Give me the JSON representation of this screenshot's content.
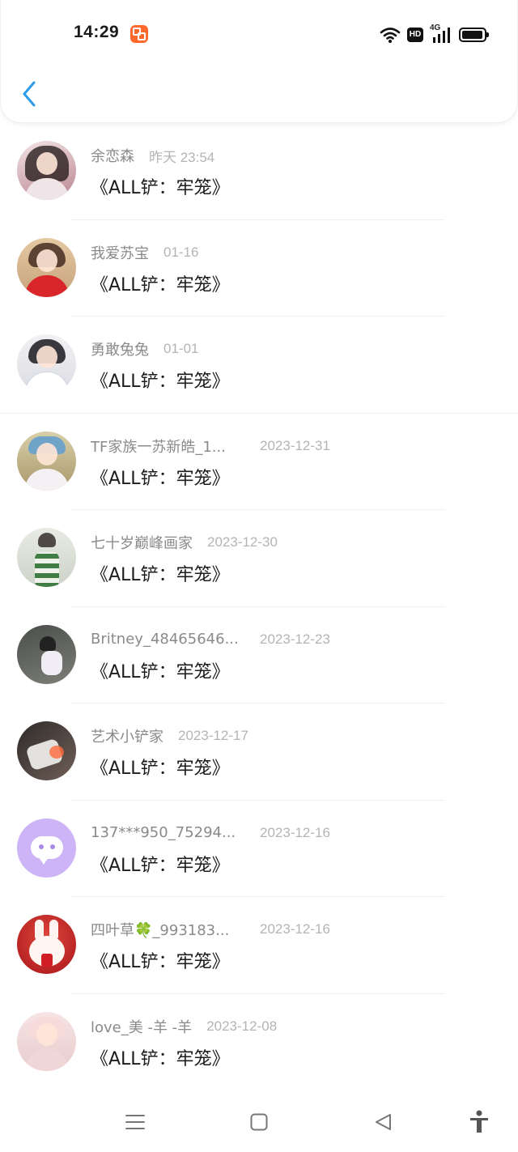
{
  "status_bar": {
    "time": "14:29",
    "hd_label": "HD",
    "network_label": "4G",
    "app_icon": "kuaishou-app-icon",
    "battery_level": 0.95
  },
  "header": {
    "back_icon": "chevron-left-icon",
    "accent_color": "#2b9bea"
  },
  "items": [
    {
      "name": "余恋森",
      "date": "昨天 23:54",
      "title": "《ALL铲：牢笼》"
    },
    {
      "name": "我爱苏宝",
      "date": "01-16",
      "title": "《ALL铲：牢笼》"
    },
    {
      "name": "勇敢兔兔",
      "date": "01-01",
      "title": "《ALL铲：牢笼》"
    },
    {
      "name": "TF家族一苏新皓_1...",
      "date": "2023-12-31",
      "title": "《ALL铲：牢笼》"
    },
    {
      "name": "七十岁巅峰画家",
      "date": "2023-12-30",
      "title": "《ALL铲：牢笼》"
    },
    {
      "name": "Britney_48465646...",
      "date": "2023-12-23",
      "title": "《ALL铲：牢笼》"
    },
    {
      "name": "艺术小铲家",
      "date": "2023-12-17",
      "title": "《ALL铲：牢笼》"
    },
    {
      "name": "137***950_75294...",
      "date": "2023-12-16",
      "title": "《ALL铲：牢笼》"
    },
    {
      "name": "四叶草🍀_993183...",
      "date": "2023-12-16",
      "title": "《ALL铲：牢笼》"
    },
    {
      "name": "love_美 -羊 -羊",
      "date": "2023-12-08",
      "title": "《ALL铲：牢笼》"
    }
  ],
  "nav_bar": {
    "icons": [
      "menu-icon",
      "home-square-icon",
      "back-triangle-icon",
      "accessibility-icon"
    ]
  }
}
